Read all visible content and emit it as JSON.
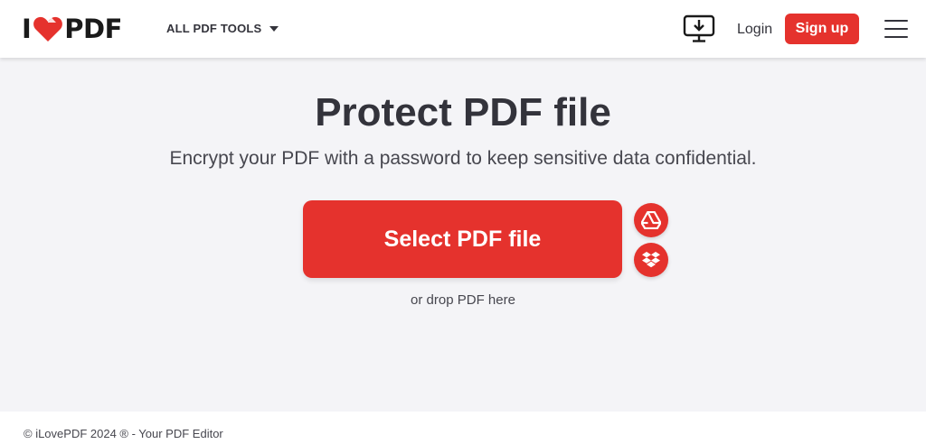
{
  "header": {
    "logo_left": "I",
    "logo_right": "PDF",
    "tools_menu_label": "ALL PDF TOOLS",
    "login_label": "Login",
    "signup_label": "Sign up"
  },
  "main": {
    "title": "Protect PDF file",
    "subtitle": "Encrypt your PDF with a password to keep sensitive data confidential.",
    "select_button_label": "Select PDF file",
    "drop_hint": "or drop PDF here",
    "cloud_sources": [
      {
        "icon": "google-drive-icon"
      },
      {
        "icon": "dropbox-icon"
      }
    ]
  },
  "footer": {
    "copyright": "© iLovePDF 2024 ® - Your PDF Editor"
  },
  "colors": {
    "brand_red": "#e5322d",
    "text_dark": "#33333b",
    "background": "#f4f4f7"
  }
}
